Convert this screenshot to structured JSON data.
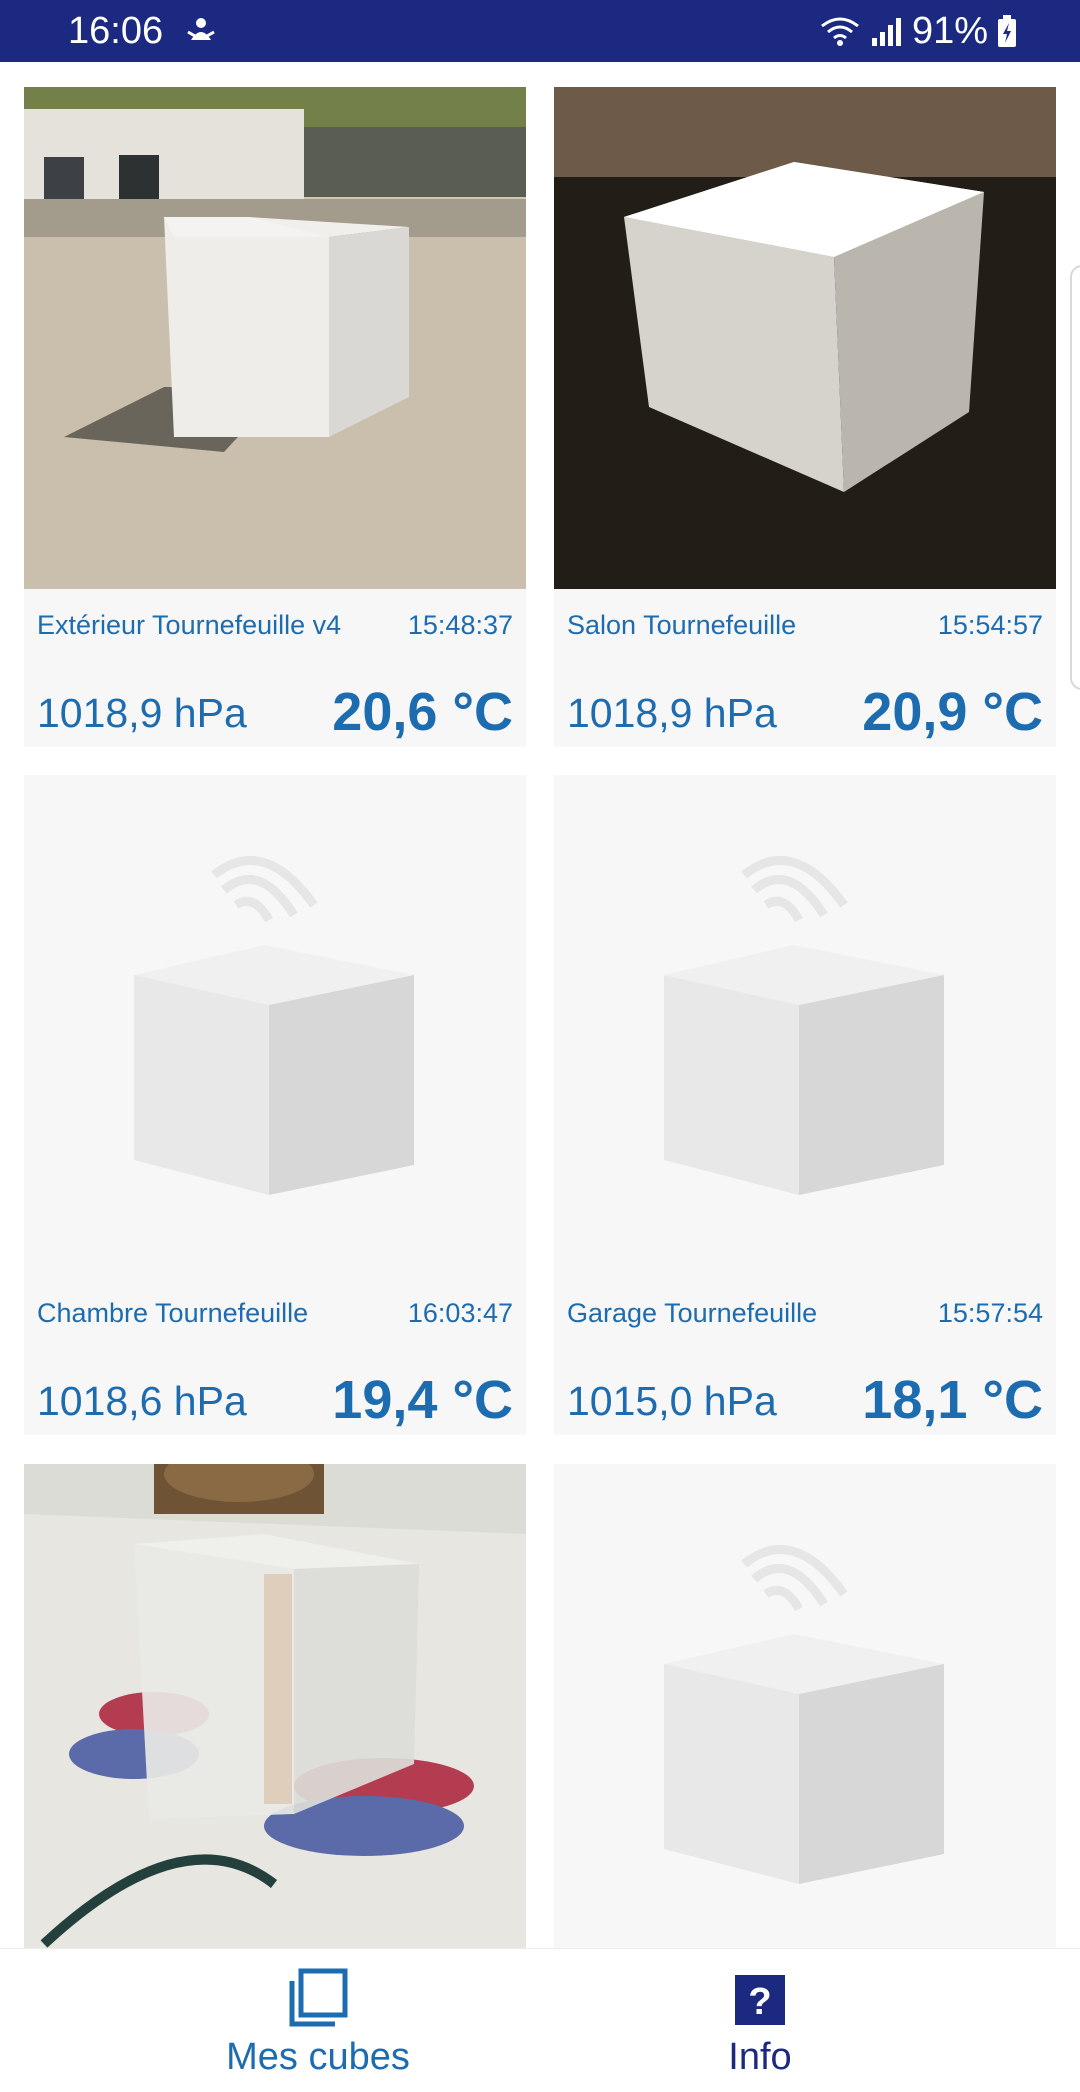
{
  "status_bar": {
    "time": "16:06",
    "battery_percent": "91%",
    "background_color": "#1b2a80"
  },
  "cards": [
    {
      "name": "Extérieur Tournefeuille v4",
      "time": "15:48:37",
      "pressure": "1018,9 hPa",
      "temperature": "20,6 °C",
      "image": "outdoor-cube-photo"
    },
    {
      "name": "Salon Tournefeuille",
      "time": "15:54:57",
      "pressure": "1018,9 hPa",
      "temperature": "20,9 °C",
      "image": "glowing-cube-photo"
    },
    {
      "name": "Chambre Tournefeuille",
      "time": "16:03:47",
      "pressure": "1018,6 hPa",
      "temperature": "19,4 °C",
      "image": "default-cube-placeholder"
    },
    {
      "name": "Garage Tournefeuille",
      "time": "15:57:54",
      "pressure": "1015,0 hPa",
      "temperature": "18,1 °C",
      "image": "default-cube-placeholder"
    },
    {
      "image": "translucent-cube-photo"
    },
    {
      "image": "default-cube-placeholder"
    }
  ],
  "bottom_nav": {
    "items": [
      {
        "label": "Mes cubes",
        "icon": "stacked-squares-icon",
        "active": true
      },
      {
        "label": "Info",
        "icon": "question-mark-icon",
        "active": false
      }
    ],
    "accent_color": "#1d6cb0",
    "inactive_color": "#1b2a80"
  },
  "accent_color": "#1d6cb0",
  "card_background": "#f7f7f7"
}
